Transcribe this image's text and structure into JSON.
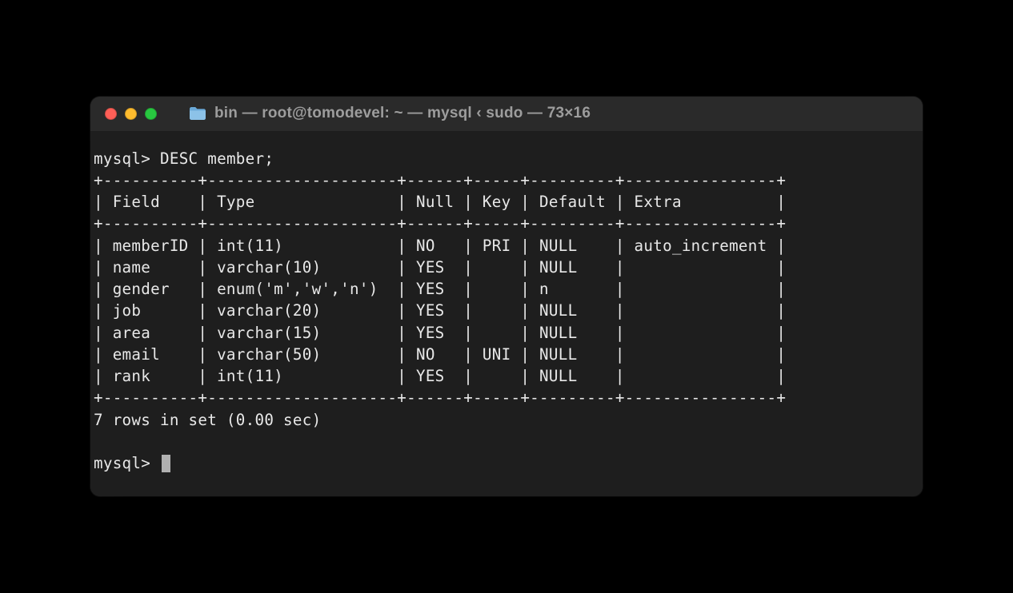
{
  "window": {
    "title": "bin — root@tomodevel: ~ — mysql ‹ sudo — 73×16"
  },
  "terminal": {
    "prompt": "mysql>",
    "command": "DESC member;",
    "footer": "7 rows in set (0.00 sec)",
    "columns": {
      "field_w": 10,
      "type_w": 20,
      "null_w": 6,
      "key_w": 5,
      "default_w": 9,
      "extra_w": 16
    },
    "headers": {
      "field": "Field",
      "type": "Type",
      "null": "Null",
      "key": "Key",
      "default": "Default",
      "extra": "Extra"
    },
    "rows": [
      {
        "field": "memberID",
        "type": "int(11)",
        "null": "NO",
        "key": "PRI",
        "default": "NULL",
        "extra": "auto_increment"
      },
      {
        "field": "name",
        "type": "varchar(10)",
        "null": "YES",
        "key": "",
        "default": "NULL",
        "extra": ""
      },
      {
        "field": "gender",
        "type": "enum('m','w','n')",
        "null": "YES",
        "key": "",
        "default": "n",
        "extra": ""
      },
      {
        "field": "job",
        "type": "varchar(20)",
        "null": "YES",
        "key": "",
        "default": "NULL",
        "extra": ""
      },
      {
        "field": "area",
        "type": "varchar(15)",
        "null": "YES",
        "key": "",
        "default": "NULL",
        "extra": ""
      },
      {
        "field": "email",
        "type": "varchar(50)",
        "null": "NO",
        "key": "UNI",
        "default": "NULL",
        "extra": ""
      },
      {
        "field": "rank",
        "type": "int(11)",
        "null": "YES",
        "key": "",
        "default": "NULL",
        "extra": ""
      }
    ]
  }
}
